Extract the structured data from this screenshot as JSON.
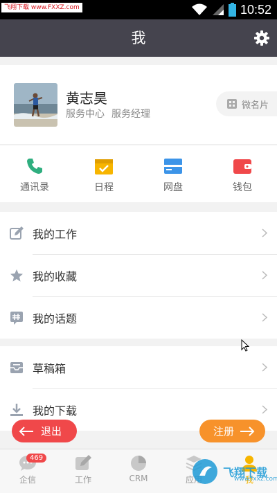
{
  "status_bar": {
    "watermark": "飞翔下载 www.FXXZ.com",
    "time": "10:52"
  },
  "header": {
    "title": "我"
  },
  "profile": {
    "name": "黄志昊",
    "department": "服务中心",
    "position": "服务经理",
    "vcard_label": "微名片"
  },
  "shortcuts": [
    {
      "label": "通讯录",
      "icon": "phone-icon",
      "color": "#2fae7f"
    },
    {
      "label": "日程",
      "icon": "calendar-icon",
      "color": "#f7b500"
    },
    {
      "label": "网盘",
      "icon": "cloud-disk-icon",
      "color": "#3c94e8"
    },
    {
      "label": "钱包",
      "icon": "wallet-icon",
      "color": "#f0484a"
    }
  ],
  "menu_group1": [
    {
      "label": "我的工作",
      "icon": "edit-icon"
    },
    {
      "label": "我的收藏",
      "icon": "star-icon"
    },
    {
      "label": "我的话题",
      "icon": "hashtag-icon"
    }
  ],
  "menu_group2": [
    {
      "label": "草稿箱",
      "icon": "draft-icon"
    },
    {
      "label": "我的下载",
      "icon": "download-icon"
    }
  ],
  "buttons": {
    "logout": "退出",
    "register": "注册"
  },
  "tabs": [
    {
      "label": "企信",
      "badge": "469"
    },
    {
      "label": "工作"
    },
    {
      "label": "CRM"
    },
    {
      "label": "应用"
    },
    {
      "label": "我"
    }
  ],
  "watermark_logo": {
    "text": "飞翔下载",
    "sub": "www.fxxz.com"
  },
  "colors": {
    "header_bg": "#45444e",
    "logout": "#f0484a",
    "register": "#f7922b",
    "active_tab": "#f7b500"
  }
}
